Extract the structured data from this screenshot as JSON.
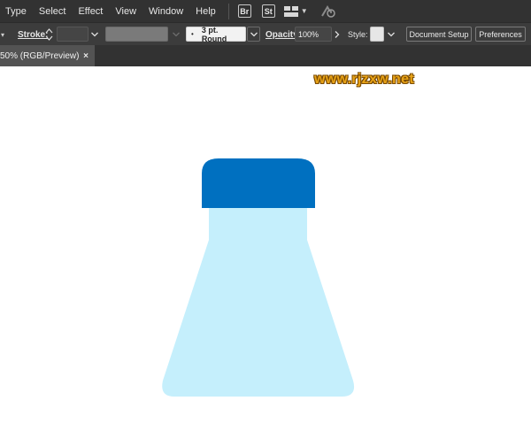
{
  "menu": {
    "items": [
      "Type",
      "Select",
      "Effect",
      "View",
      "Window",
      "Help"
    ],
    "bridge_badge": "Br",
    "stock_badge": "St"
  },
  "control_bar": {
    "stroke_label": "Stroke:",
    "brush_value": "3 pt. Round",
    "opacity_label": "Opacity:",
    "opacity_value": "100%",
    "style_label": "Style:",
    "document_setup_label": "Document Setup",
    "preferences_label": "Preferences"
  },
  "document_tab": {
    "title": "50% (RGB/Preview)",
    "close": "×"
  },
  "watermark": "www.rjzxw.net",
  "colors": {
    "cap": "#0070C0",
    "bottle": "#C5EFFC",
    "menubar": "#323232",
    "controlbar": "#3C3C3C"
  }
}
